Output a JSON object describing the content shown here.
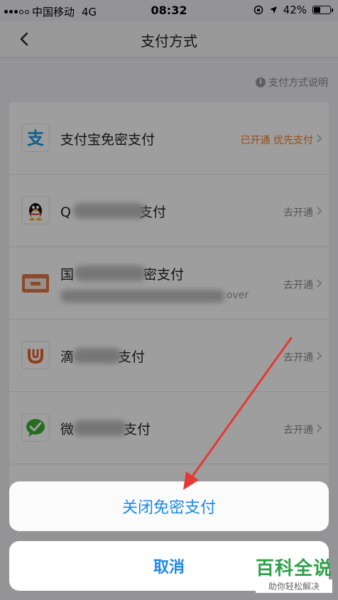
{
  "status_bar": {
    "carrier": "中国移动",
    "network": "4G",
    "time": "08:32",
    "battery": "42%",
    "battery_level": 0.42
  },
  "nav": {
    "title": "支付方式"
  },
  "help": {
    "label": "支付方式说明"
  },
  "payments": [
    {
      "name": "支付宝免密支付",
      "status": "已开通 优先支付",
      "active": true,
      "icon": "alipay-icon"
    },
    {
      "name_a": "Q",
      "name_b": "支付",
      "status": "去开通",
      "icon": "qq-icon"
    },
    {
      "name_a": "国",
      "name_b": "密支付",
      "sub": "over",
      "status": "去开通",
      "icon": "card-icon"
    },
    {
      "name_a": "滴",
      "name_b": "支付",
      "status": "去开通",
      "icon": "didi-icon"
    },
    {
      "name_a": "微",
      "name_b": "支付",
      "status": "去开通",
      "icon": "wechat-icon"
    }
  ],
  "sheet": {
    "action": "关闭免密支付",
    "cancel": "取消"
  },
  "watermark": {
    "big": "百科全说",
    "small": "助你轻松解决"
  },
  "colors": {
    "accent": "#1e88e5",
    "active": "#ef7b26",
    "arrow": "#e53935"
  }
}
